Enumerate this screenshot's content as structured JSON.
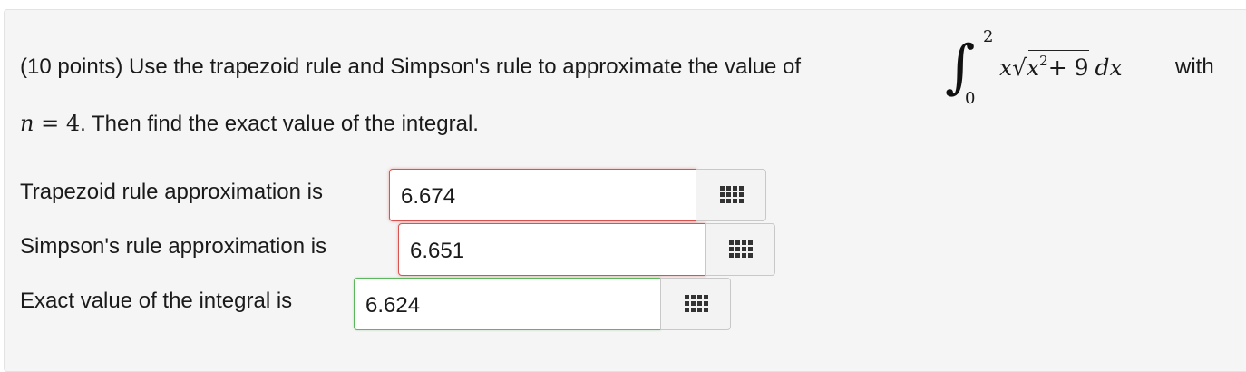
{
  "question": {
    "prefix": "(10 points) Use the trapezoid rule and Simpson's rule to approximate the value of",
    "integral": {
      "symbol": "∫",
      "upper_limit": "2",
      "lower_limit": "0",
      "x": "x",
      "radicand_x": "x",
      "exponent": "2",
      "plus_nine": "+ 9",
      "dx": "dx"
    },
    "with_word": "with",
    "n_var": "n",
    "n_eq": " = 4",
    "line2_rest": ". Then find the exact value of the integral."
  },
  "answers": [
    {
      "label": "Trapezoid rule approximation is",
      "value": "6.674",
      "status": "incorrect"
    },
    {
      "label": "Simpson's rule approximation is",
      "value": "6.651",
      "status": "incorrect"
    },
    {
      "label": "Exact value of the integral is",
      "value": "6.624",
      "status": "correct"
    }
  ],
  "icons": {
    "equation_editor": "grid-keypad-icon"
  },
  "colors": {
    "incorrect": "#d9534f",
    "correct": "#5cb85c"
  }
}
